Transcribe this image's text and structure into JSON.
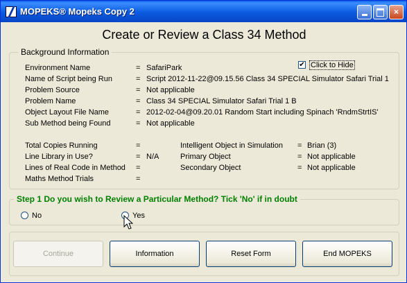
{
  "window": {
    "title": "MOPEKS® Mopeks Copy 2",
    "controls": {
      "minimize": "minimize-icon",
      "maximize": "maximize-icon",
      "close": "×"
    }
  },
  "heading": "Create or Review a Class 34 Method",
  "background_info": {
    "legend": "Background Information",
    "hide_checkbox": {
      "label": "Click to Hide",
      "checked": true,
      "mark": "✔"
    },
    "rows": [
      {
        "label": "Environment Name",
        "eq": "=",
        "value": "SafariPark"
      },
      {
        "label": "Name of Script being Run",
        "eq": "=",
        "value": "Script 2012-11-22@09.15.56 Class 34 SPECIAL Simulator Safari Trial 1"
      },
      {
        "label": "Problem Source",
        "eq": "=",
        "value": "Not applicable"
      },
      {
        "label": "Problem Name",
        "eq": "=",
        "value": "Class 34 SPECIAL Simulator Safari Trial 1 B"
      },
      {
        "label": "Object Layout File Name",
        "eq": "=",
        "value": "2012-02-04@09.20.01 Random Start including Spinach 'RndmStrtIS'"
      },
      {
        "label": "Sub Method being Found",
        "eq": "=",
        "value": "Not applicable"
      }
    ],
    "left_stats": [
      {
        "label": "Total Copies Running",
        "eq": "=",
        "value": ""
      },
      {
        "label": "Line Library in Use?",
        "eq": "=",
        "value": "N/A"
      },
      {
        "label": "Lines of Real Code in Method",
        "eq": "=",
        "value": ""
      },
      {
        "label": "Maths Method Trials",
        "eq": "=",
        "value": ""
      }
    ],
    "right_stats": [
      {
        "label": "Intelligent Object in Simulation",
        "eq": "=",
        "value": "Brian (3)"
      },
      {
        "label": "Primary Object",
        "eq": "=",
        "value": "Not applicable"
      },
      {
        "label": "Secondary Object",
        "eq": "=",
        "value": "Not applicable"
      }
    ]
  },
  "step1": {
    "legend": "Step 1   Do you wish to Review a Particular Method? Tick 'No' if in doubt",
    "options": [
      {
        "label": "No",
        "selected": false
      },
      {
        "label": "Yes",
        "selected": false
      }
    ]
  },
  "buttons": {
    "continue": "Continue",
    "information": "Information",
    "reset": "Reset Form",
    "end": "End MOPEKS"
  }
}
